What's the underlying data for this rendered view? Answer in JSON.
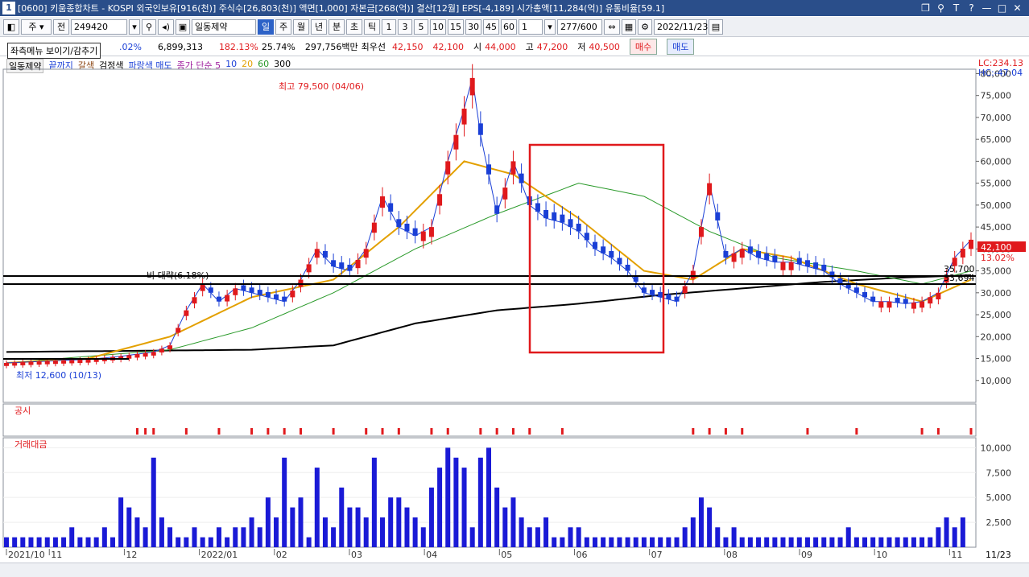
{
  "window": {
    "number": "1",
    "title": "[0600] 키움종합차트 - KOSPI 외국인보유[916(천)] 주식수[26,803(천)] 액면[1,000] 자본금[268(억)] 결산[12월] EPS[-4,189] 시가총액[11,284(억)] 유통비율[59.1]"
  },
  "toolbar": {
    "market": "주",
    "price_type": "전",
    "code": "249420",
    "stock_name": "일동제약",
    "periods": [
      "일",
      "주",
      "월",
      "년",
      "분",
      "초",
      "틱"
    ],
    "intervals": [
      "1",
      "3",
      "5",
      "10",
      "15",
      "30",
      "45",
      "60"
    ],
    "count_value": "1",
    "range": "277/600",
    "date": "2022/11/23"
  },
  "quote": {
    "change_pct": ".02%",
    "volume": "6,899,313",
    "vol_ratio": "182.13%",
    "turnover": "25.74%",
    "amount": "297,756백만",
    "pref_label": "최우선",
    "ask": "42,150",
    "bid": "42,100",
    "open_label": "시",
    "open": "44,000",
    "high_label": "고",
    "high": "47,200",
    "low_label": "저",
    "low": "40,500",
    "buy": "매수",
    "sell": "매도"
  },
  "tooltip": "좌측메뉴 보이기/감추기",
  "legend": {
    "name": "일동제약",
    "items": [
      "끝까지",
      "갈색",
      "검정색",
      "파랑색 매도",
      "종가 단순 5",
      "10",
      "20",
      "60",
      "300"
    ]
  },
  "chart_labels": {
    "lc": "LC:234.13",
    "hc": "HC:-47.04",
    "max_label": "최고 79,500 (04/06)",
    "min_label": "최저 12,600 (10/13)",
    "trend_label": "비 대략(6.18%)",
    "level_1": "35,700",
    "level_2": "33,694",
    "last_price": "42,100",
    "last_pct": "13.02%",
    "disclosure_title": "공시",
    "amount_title": "거래대금"
  },
  "chart_data": {
    "type": "candlestick",
    "price_axis": {
      "ticks": [
        "80,000",
        "75,000",
        "70,000",
        "65,000",
        "60,000",
        "55,000",
        "50,000",
        "45,000",
        "40,000",
        "35,000",
        "30,000",
        "25,000",
        "20,000",
        "15,000",
        "10,000"
      ],
      "ylim": [
        5000,
        81000
      ]
    },
    "amount_axis": {
      "ticks": [
        "10,000",
        "7,500",
        "5,000",
        "2,500"
      ],
      "ylim": [
        0,
        11000
      ]
    },
    "x_ticks": [
      "2021/10",
      "11",
      "12",
      "2022/01",
      "02",
      "03",
      "04",
      "05",
      "06",
      "07",
      "08",
      "09",
      "10",
      "11"
    ],
    "last_date": "11/23",
    "close_path": [
      [
        0,
        14000
      ],
      [
        6,
        14500
      ],
      [
        10,
        14800
      ],
      [
        14,
        15500
      ],
      [
        18,
        16500
      ],
      [
        20,
        18000
      ],
      [
        22,
        26000
      ],
      [
        24,
        32000
      ],
      [
        26,
        28000
      ],
      [
        28,
        31000
      ],
      [
        30,
        30000
      ],
      [
        32,
        29000
      ],
      [
        34,
        28000
      ],
      [
        36,
        33000
      ],
      [
        38,
        40000
      ],
      [
        40,
        36000
      ],
      [
        42,
        35000
      ],
      [
        44,
        40000
      ],
      [
        46,
        52000
      ],
      [
        48,
        45000
      ],
      [
        50,
        43000
      ],
      [
        52,
        45000
      ],
      [
        54,
        60000
      ],
      [
        56,
        72000
      ],
      [
        57,
        79000
      ],
      [
        58,
        66000
      ],
      [
        60,
        48000
      ],
      [
        62,
        60000
      ],
      [
        64,
        50000
      ],
      [
        66,
        47000
      ],
      [
        68,
        46000
      ],
      [
        70,
        44000
      ],
      [
        72,
        40000
      ],
      [
        74,
        38000
      ],
      [
        76,
        35000
      ],
      [
        78,
        30000
      ],
      [
        80,
        29000
      ],
      [
        82,
        28000
      ],
      [
        84,
        35000
      ],
      [
        86,
        55000
      ],
      [
        88,
        38000
      ],
      [
        90,
        40000
      ],
      [
        92,
        38000
      ],
      [
        94,
        37000
      ],
      [
        96,
        37000
      ],
      [
        98,
        36000
      ],
      [
        100,
        35000
      ],
      [
        102,
        32000
      ],
      [
        104,
        30000
      ],
      [
        106,
        28000
      ],
      [
        108,
        28000
      ],
      [
        110,
        27500
      ],
      [
        112,
        28000
      ],
      [
        114,
        30000
      ],
      [
        116,
        38000
      ],
      [
        118,
        42100
      ]
    ],
    "ma20_path": [
      [
        0,
        14000
      ],
      [
        10,
        15000
      ],
      [
        20,
        20000
      ],
      [
        30,
        29000
      ],
      [
        40,
        33000
      ],
      [
        48,
        45000
      ],
      [
        56,
        60000
      ],
      [
        62,
        57000
      ],
      [
        70,
        47000
      ],
      [
        78,
        35000
      ],
      [
        84,
        33000
      ],
      [
        90,
        40000
      ],
      [
        96,
        38000
      ],
      [
        104,
        32000
      ],
      [
        112,
        28000
      ],
      [
        118,
        33000
      ]
    ],
    "ma60_path": [
      [
        0,
        14000
      ],
      [
        20,
        17000
      ],
      [
        30,
        22000
      ],
      [
        40,
        30000
      ],
      [
        50,
        40000
      ],
      [
        60,
        48000
      ],
      [
        70,
        55000
      ],
      [
        78,
        52000
      ],
      [
        86,
        44000
      ],
      [
        94,
        38000
      ],
      [
        104,
        35000
      ],
      [
        112,
        32000
      ],
      [
        118,
        35000
      ]
    ],
    "ma300_path": [
      [
        0,
        16500
      ],
      [
        30,
        17000
      ],
      [
        40,
        18000
      ],
      [
        50,
        23000
      ],
      [
        60,
        26000
      ],
      [
        70,
        27500
      ],
      [
        80,
        29500
      ],
      [
        90,
        31000
      ],
      [
        100,
        32500
      ],
      [
        110,
        33500
      ],
      [
        118,
        34000
      ]
    ],
    "amount_bars": [
      1,
      1,
      1,
      1,
      1,
      1,
      1,
      1,
      2,
      1,
      1,
      1,
      2,
      1,
      5,
      4,
      3,
      2,
      9,
      3,
      2,
      1,
      1,
      2,
      1,
      1,
      2,
      1,
      2,
      2,
      3,
      2,
      5,
      3,
      9,
      4,
      5,
      1,
      8,
      3,
      2,
      6,
      4,
      4,
      3,
      9,
      3,
      5,
      5,
      4,
      3,
      2,
      6,
      8,
      10,
      9,
      8,
      2,
      9,
      10,
      6,
      4,
      5,
      3,
      2,
      2,
      3,
      1,
      1,
      2,
      2,
      1,
      1,
      1,
      1,
      1,
      1,
      1,
      1,
      1,
      1,
      1,
      1,
      2,
      3,
      5,
      4,
      2,
      1,
      2,
      1,
      1,
      1,
      1,
      1,
      1,
      1,
      1,
      1,
      1,
      1,
      1,
      1,
      2,
      1,
      1,
      1,
      1,
      1,
      1,
      1,
      1,
      1,
      1,
      2,
      3,
      2,
      3
    ]
  }
}
